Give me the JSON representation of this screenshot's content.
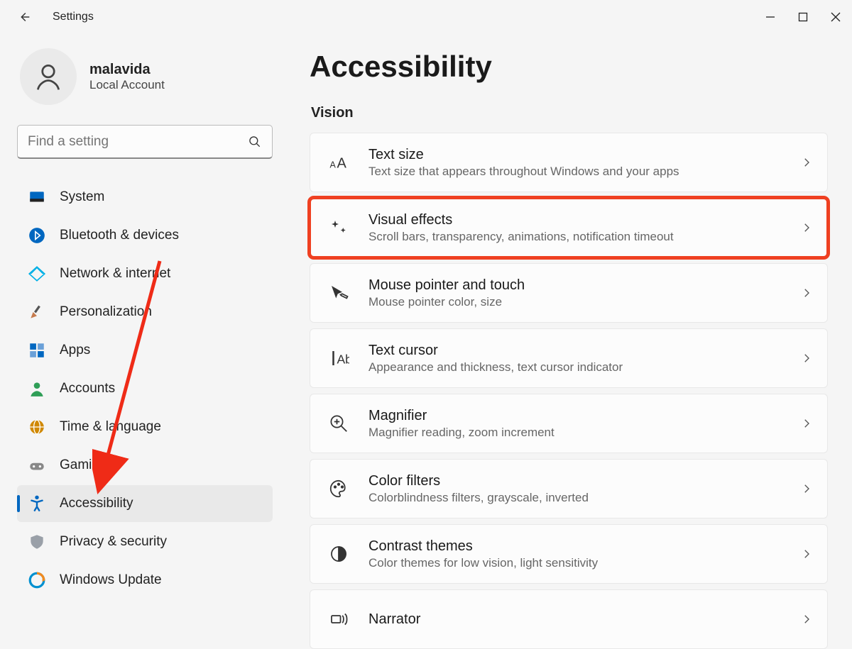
{
  "titlebar": {
    "title": "Settings"
  },
  "account": {
    "name": "malavida",
    "sub": "Local Account"
  },
  "search": {
    "placeholder": "Find a setting"
  },
  "nav": [
    {
      "label": "System",
      "icon": "system"
    },
    {
      "label": "Bluetooth & devices",
      "icon": "bluetooth"
    },
    {
      "label": "Network & internet",
      "icon": "wifi"
    },
    {
      "label": "Personalization",
      "icon": "brush"
    },
    {
      "label": "Apps",
      "icon": "apps"
    },
    {
      "label": "Accounts",
      "icon": "accounts"
    },
    {
      "label": "Time & language",
      "icon": "globe"
    },
    {
      "label": "Gaming",
      "icon": "gaming"
    },
    {
      "label": "Accessibility",
      "icon": "accessibility",
      "selected": true
    },
    {
      "label": "Privacy & security",
      "icon": "shield"
    },
    {
      "label": "Windows Update",
      "icon": "update"
    }
  ],
  "page": {
    "title": "Accessibility",
    "section": "Vision",
    "cards": [
      {
        "title": "Text size",
        "sub": "Text size that appears throughout Windows and your apps",
        "icon": "text-size"
      },
      {
        "title": "Visual effects",
        "sub": "Scroll bars, transparency, animations, notification timeout",
        "icon": "sparkle",
        "highlight": true
      },
      {
        "title": "Mouse pointer and touch",
        "sub": "Mouse pointer color, size",
        "icon": "cursor"
      },
      {
        "title": "Text cursor",
        "sub": "Appearance and thickness, text cursor indicator",
        "icon": "text-cursor"
      },
      {
        "title": "Magnifier",
        "sub": "Magnifier reading, zoom increment",
        "icon": "magnifier"
      },
      {
        "title": "Color filters",
        "sub": "Colorblindness filters, grayscale, inverted",
        "icon": "palette"
      },
      {
        "title": "Contrast themes",
        "sub": "Color themes for low vision, light sensitivity",
        "icon": "contrast"
      },
      {
        "title": "Narrator",
        "sub": "",
        "icon": "narrator"
      }
    ]
  }
}
